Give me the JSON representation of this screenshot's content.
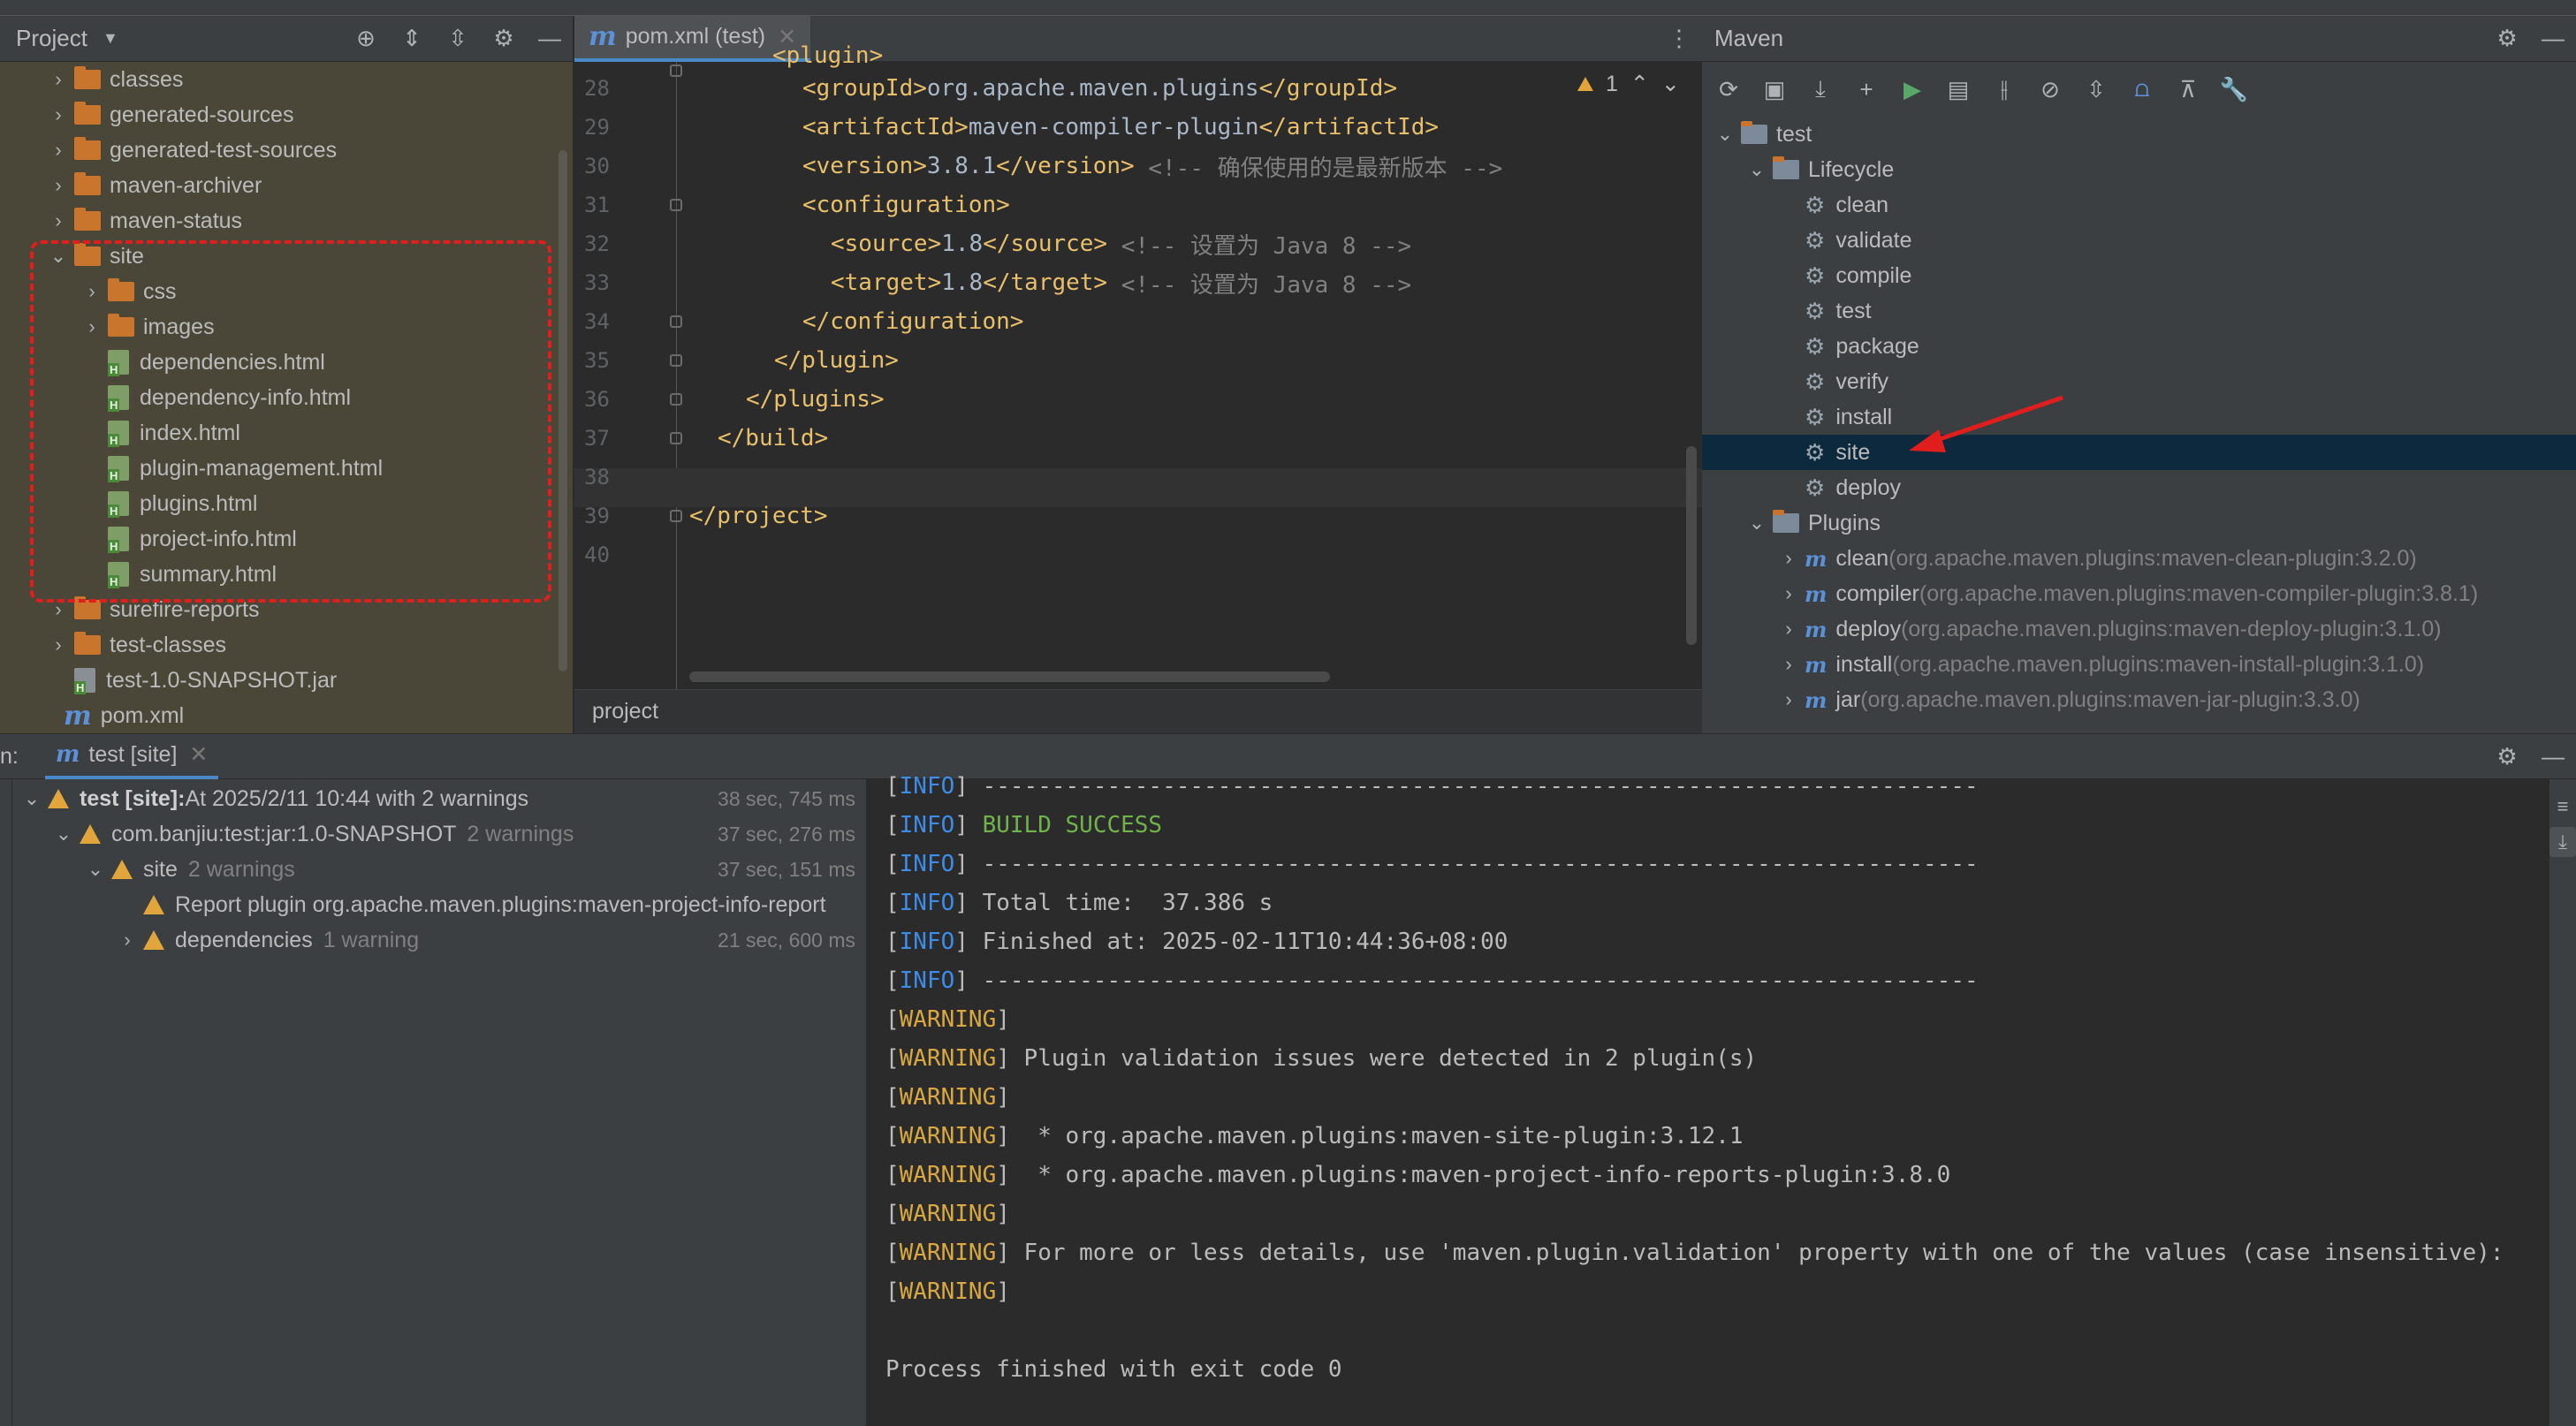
{
  "project_panel": {
    "title": "Project",
    "items": [
      {
        "label": "classes",
        "type": "folder",
        "level": 1,
        "chevron": "›"
      },
      {
        "label": "generated-sources",
        "type": "folder",
        "level": 1,
        "chevron": "›"
      },
      {
        "label": "generated-test-sources",
        "type": "folder",
        "level": 1,
        "chevron": "›"
      },
      {
        "label": "maven-archiver",
        "type": "folder",
        "level": 1,
        "chevron": "›"
      },
      {
        "label": "maven-status",
        "type": "folder",
        "level": 1,
        "chevron": "›"
      },
      {
        "label": "site",
        "type": "folder",
        "level": 1,
        "chevron": "⌄"
      },
      {
        "label": "css",
        "type": "folder",
        "level": 2,
        "chevron": "›"
      },
      {
        "label": "images",
        "type": "folder",
        "level": 2,
        "chevron": "›"
      },
      {
        "label": "dependencies.html",
        "type": "html",
        "level": 2,
        "chevron": ""
      },
      {
        "label": "dependency-info.html",
        "type": "html",
        "level": 2,
        "chevron": ""
      },
      {
        "label": "index.html",
        "type": "html",
        "level": 2,
        "chevron": ""
      },
      {
        "label": "plugin-management.html",
        "type": "html",
        "level": 2,
        "chevron": ""
      },
      {
        "label": "plugins.html",
        "type": "html",
        "level": 2,
        "chevron": ""
      },
      {
        "label": "project-info.html",
        "type": "html",
        "level": 2,
        "chevron": ""
      },
      {
        "label": "summary.html",
        "type": "html",
        "level": 2,
        "chevron": ""
      },
      {
        "label": "surefire-reports",
        "type": "folder",
        "level": 1,
        "chevron": "›"
      },
      {
        "label": "test-classes",
        "type": "folder",
        "level": 1,
        "chevron": "›"
      },
      {
        "label": "test-1.0-SNAPSHOT.jar",
        "type": "jar",
        "level": 1,
        "chevron": ""
      },
      {
        "label": "pom.xml",
        "type": "maven",
        "level": 0,
        "chevron": ""
      }
    ]
  },
  "editor": {
    "tab_label": "pom.xml (test)",
    "warning_count": "1",
    "breadcrumb": "project",
    "lines": [
      {
        "num": "28",
        "indent": 4,
        "parts": [
          [
            "tag",
            "<groupId>"
          ],
          [
            "txt",
            "org.apache.maven.plugins"
          ],
          [
            "tag",
            "</groupId>"
          ]
        ]
      },
      {
        "num": "29",
        "indent": 4,
        "parts": [
          [
            "tag",
            "<artifactId>"
          ],
          [
            "txt",
            "maven-compiler-plugin"
          ],
          [
            "tag",
            "</artifactId>"
          ]
        ]
      },
      {
        "num": "30",
        "indent": 4,
        "parts": [
          [
            "tag",
            "<version>"
          ],
          [
            "txt",
            "3.8.1"
          ],
          [
            "tag",
            "</version>"
          ],
          [
            "cmt",
            " <!-- 确保使用的是最新版本 -->"
          ]
        ]
      },
      {
        "num": "31",
        "indent": 4,
        "parts": [
          [
            "tag",
            "<configuration>"
          ]
        ]
      },
      {
        "num": "32",
        "indent": 5,
        "parts": [
          [
            "tag",
            "<source>"
          ],
          [
            "txt",
            "1.8"
          ],
          [
            "tag",
            "</source>"
          ],
          [
            "cmt",
            " <!-- 设置为 Java 8 -->"
          ]
        ]
      },
      {
        "num": "33",
        "indent": 5,
        "parts": [
          [
            "tag",
            "<target>"
          ],
          [
            "txt",
            "1.8"
          ],
          [
            "tag",
            "</target>"
          ],
          [
            "cmt",
            " <!-- 设置为 Java 8 -->"
          ]
        ]
      },
      {
        "num": "34",
        "indent": 4,
        "parts": [
          [
            "tag",
            "</configuration>"
          ]
        ]
      },
      {
        "num": "35",
        "indent": 3,
        "parts": [
          [
            "tag",
            "</plugin>"
          ]
        ]
      },
      {
        "num": "36",
        "indent": 2,
        "parts": [
          [
            "tag",
            "</plugins>"
          ]
        ]
      },
      {
        "num": "37",
        "indent": 1,
        "parts": [
          [
            "tag",
            "</build>"
          ]
        ]
      },
      {
        "num": "38",
        "indent": 0,
        "parts": []
      },
      {
        "num": "39",
        "indent": 0,
        "parts": [
          [
            "tag",
            "</project>"
          ]
        ]
      },
      {
        "num": "40",
        "indent": 0,
        "parts": []
      }
    ]
  },
  "maven_panel": {
    "title": "Maven",
    "root": "test",
    "lifecycle_label": "Lifecycle",
    "lifecycle": [
      "clean",
      "validate",
      "compile",
      "test",
      "package",
      "verify",
      "install",
      "site",
      "deploy"
    ],
    "selected_goal": "site",
    "plugins_label": "Plugins",
    "plugins": [
      {
        "name": "clean",
        "coord": "(org.apache.maven.plugins:maven-clean-plugin:3.2.0)"
      },
      {
        "name": "compiler",
        "coord": "(org.apache.maven.plugins:maven-compiler-plugin:3.8.1)"
      },
      {
        "name": "deploy",
        "coord": "(org.apache.maven.plugins:maven-deploy-plugin:3.1.0)"
      },
      {
        "name": "install",
        "coord": "(org.apache.maven.plugins:maven-install-plugin:3.1.0)"
      },
      {
        "name": "jar",
        "coord": "(org.apache.maven.plugins:maven-jar-plugin:3.3.0)"
      }
    ]
  },
  "run_panel": {
    "prefix": "n:",
    "tab_label": "test [site]",
    "tree": [
      {
        "level": 0,
        "chevron": "⌄",
        "warn": true,
        "bold": "test [site]:",
        "text": " At 2025/2/11 10:44 with 2 warnings",
        "extra": "",
        "duration": "38 sec, 745 ms"
      },
      {
        "level": 1,
        "chevron": "⌄",
        "warn": true,
        "bold": "",
        "text": "com.banjiu:test:jar:1.0-SNAPSHOT",
        "extra": "2 warnings",
        "duration": "37 sec, 276 ms"
      },
      {
        "level": 2,
        "chevron": "⌄",
        "warn": true,
        "bold": "",
        "text": "site",
        "extra": "2 warnings",
        "duration": "37 sec, 151 ms"
      },
      {
        "level": 3,
        "chevron": "",
        "warn": true,
        "bold": "",
        "text": "Report plugin org.apache.maven.plugins:maven-project-info-report",
        "extra": "",
        "duration": ""
      },
      {
        "level": 3,
        "chevron": "›",
        "warn": true,
        "bold": "",
        "text": "dependencies",
        "extra": "1 warning",
        "duration": "21 sec, 600 ms"
      }
    ],
    "console": [
      {
        "tag": "INFO",
        "msg": " ------------------------------------------------------------------------",
        "cls": ""
      },
      {
        "tag": "INFO",
        "msg": " BUILD SUCCESS",
        "cls": "succ"
      },
      {
        "tag": "INFO",
        "msg": " ------------------------------------------------------------------------",
        "cls": ""
      },
      {
        "tag": "INFO",
        "msg": " Total time:  37.386 s",
        "cls": ""
      },
      {
        "tag": "INFO",
        "msg": " Finished at: 2025-02-11T10:44:36+08:00",
        "cls": ""
      },
      {
        "tag": "INFO",
        "msg": " ------------------------------------------------------------------------",
        "cls": ""
      },
      {
        "tag": "WARNING",
        "msg": "",
        "cls": ""
      },
      {
        "tag": "WARNING",
        "msg": " Plugin validation issues were detected in 2 plugin(s)",
        "cls": ""
      },
      {
        "tag": "WARNING",
        "msg": "",
        "cls": ""
      },
      {
        "tag": "WARNING",
        "msg": "  * org.apache.maven.plugins:maven-site-plugin:3.12.1",
        "cls": ""
      },
      {
        "tag": "WARNING",
        "msg": "  * org.apache.maven.plugins:maven-project-info-reports-plugin:3.8.0",
        "cls": ""
      },
      {
        "tag": "WARNING",
        "msg": "",
        "cls": ""
      },
      {
        "tag": "WARNING",
        "msg": " For more or less details, use 'maven.plugin.validation' property with one of the values (case insensitive):",
        "cls": ""
      },
      {
        "tag": "WARNING",
        "msg": "",
        "cls": ""
      },
      {
        "tag": "",
        "msg": "",
        "cls": ""
      },
      {
        "tag": "",
        "msg": "Process finished with exit code 0",
        "cls": ""
      }
    ]
  },
  "colors": {
    "accent": "#3d8ce8",
    "selection": "#0d293e",
    "annotation": "#e01e1e",
    "warning": "#e2a53b"
  }
}
